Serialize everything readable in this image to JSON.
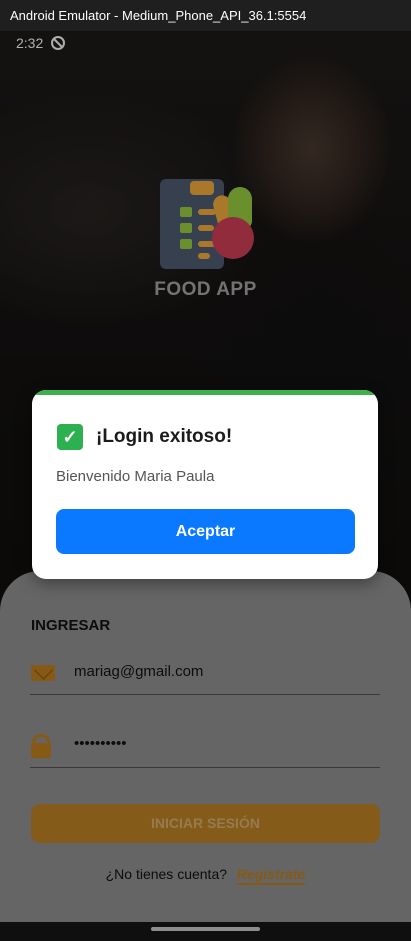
{
  "window": {
    "title": "Android Emulator - Medium_Phone_API_36.1:5554"
  },
  "status_bar": {
    "time": "2:32",
    "dnd_icon": "do-not-disturb-icon"
  },
  "app": {
    "name": "FOOD APP",
    "logo_icon": "food-checklist-logo"
  },
  "login_sheet": {
    "title": "INGRESAR",
    "email_icon": "mail-icon",
    "email_value": "mariag@gmail.com",
    "password_icon": "lock-icon",
    "password_value": "••••••••••",
    "submit_label": "INICIAR SESIÓN",
    "no_account_text": "¿No tienes cuenta?",
    "register_label": "Regístrate"
  },
  "dialog": {
    "icon": "check-mark-icon",
    "title": "¡Login exitoso!",
    "message": "Bienvenido Maria Paula",
    "accept_label": "Aceptar",
    "accent_color": "#3fb04b",
    "button_color": "#0a78ff"
  },
  "colors": {
    "brand": "#b3781e"
  }
}
